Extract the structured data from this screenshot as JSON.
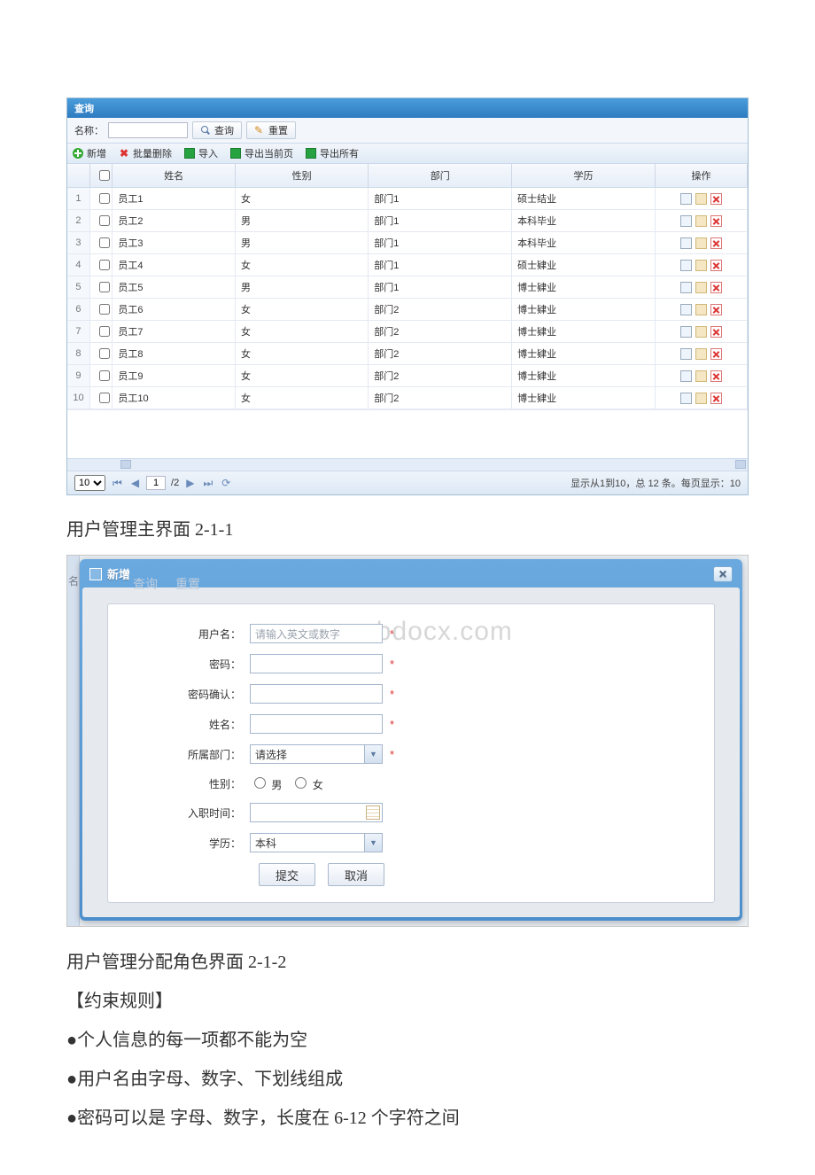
{
  "panel": {
    "title": "查询",
    "name_label": "名称：",
    "search_btn": "查询",
    "reset_btn": "重置",
    "toolbar": {
      "add": "新增",
      "batch_delete": "批量删除",
      "import": "导入",
      "export_page": "导出当前页",
      "export_all": "导出所有"
    },
    "columns": {
      "name": "姓名",
      "gender": "性别",
      "dept": "部门",
      "edu": "学历",
      "op": "操作"
    },
    "rows": [
      {
        "n": "1",
        "name": "员工1",
        "gender": "女",
        "dept": "部门1",
        "edu": "硕士结业"
      },
      {
        "n": "2",
        "name": "员工2",
        "gender": "男",
        "dept": "部门1",
        "edu": "本科毕业"
      },
      {
        "n": "3",
        "name": "员工3",
        "gender": "男",
        "dept": "部门1",
        "edu": "本科毕业"
      },
      {
        "n": "4",
        "name": "员工4",
        "gender": "女",
        "dept": "部门1",
        "edu": "硕士肄业"
      },
      {
        "n": "5",
        "name": "员工5",
        "gender": "男",
        "dept": "部门1",
        "edu": "博士肄业"
      },
      {
        "n": "6",
        "name": "员工6",
        "gender": "女",
        "dept": "部门2",
        "edu": "博士肄业"
      },
      {
        "n": "7",
        "name": "员工7",
        "gender": "女",
        "dept": "部门2",
        "edu": "博士肄业"
      },
      {
        "n": "8",
        "name": "员工8",
        "gender": "女",
        "dept": "部门2",
        "edu": "博士肄业"
      },
      {
        "n": "9",
        "name": "员工9",
        "gender": "女",
        "dept": "部门2",
        "edu": "博士肄业"
      },
      {
        "n": "10",
        "name": "员工10",
        "gender": "女",
        "dept": "部门2",
        "edu": "博士肄业"
      }
    ],
    "pager": {
      "size": "10",
      "page": "1",
      "total_pages": "/2",
      "status": "显示从1到10，总 12 条。每页显示：10"
    }
  },
  "caption1": "用户管理主界面 2-1-1",
  "dialog": {
    "title": "新增",
    "ghost1": "查询",
    "ghost2": "重置",
    "left_char": "名",
    "watermark": "www.bdocx.com",
    "labels": {
      "username": "用户名：",
      "password": "密码：",
      "confirm": "密码确认：",
      "realname": "姓名：",
      "dept": "所属部门：",
      "gender": "性别：",
      "hire": "入职时间：",
      "edu": "学历："
    },
    "username_placeholder": "请输入英文或数字",
    "dept_placeholder": "请选择",
    "gender_male": "男",
    "gender_female": "女",
    "edu_value": "本科",
    "submit": "提交",
    "cancel": "取消"
  },
  "caption2": "用户管理分配角色界面 2-1-2",
  "rules_heading": "【约束规则】",
  "rules": [
    "●个人信息的每一项都不能为空",
    "●用户名由字母、数字、下划线组成",
    "●密码可以是 字母、数字，长度在 6-12 个字符之间"
  ]
}
